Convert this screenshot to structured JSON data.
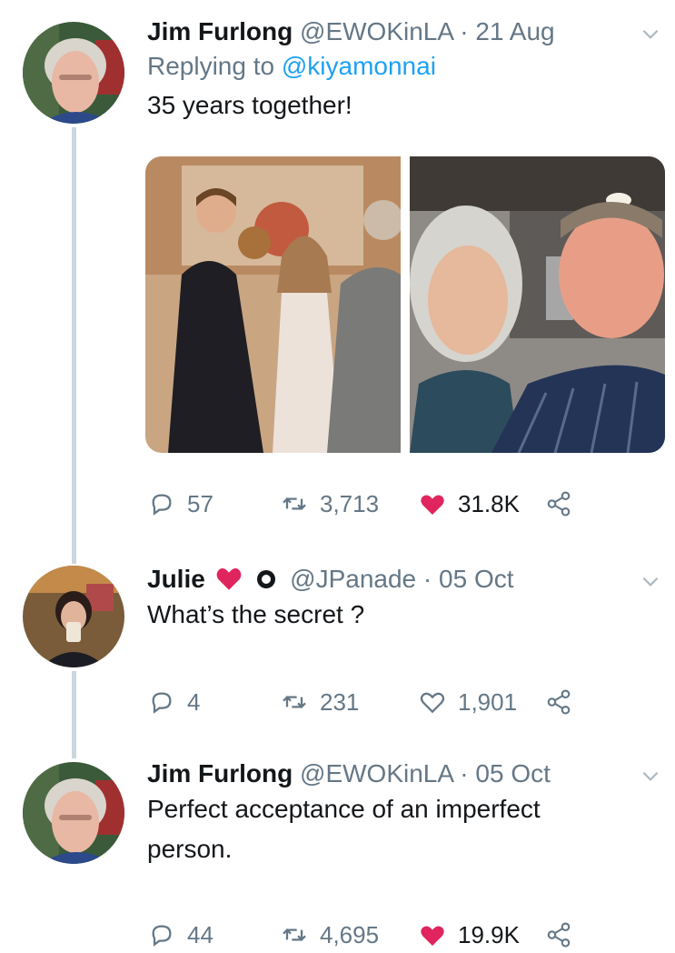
{
  "tweets": [
    {
      "name": "Jim Furlong",
      "handle": "@EWOKinLA",
      "dot": "·",
      "date": "21 Aug",
      "replying_prefix": "Replying to",
      "replying_to": "@kiyamonnai",
      "text": "35 years together!",
      "replies": "57",
      "retweets": "3,713",
      "likes": "31.8K",
      "liked": true
    },
    {
      "name": "Julie",
      "handle": "@JPanade",
      "dot": "·",
      "date": "05 Oct",
      "text": "What’s the secret ?",
      "replies": "4",
      "retweets": "231",
      "likes": "1,901",
      "liked": false
    },
    {
      "name": "Jim Furlong",
      "handle": "@EWOKinLA",
      "dot": "·",
      "date": "05 Oct",
      "text_line1": "Perfect acceptance of an imperfect",
      "text_line2": "person.",
      "replies": "44",
      "retweets": "4,695",
      "likes": "19.9K",
      "liked": true
    }
  ],
  "colors": {
    "text": "#14171a",
    "secondary": "#657786",
    "link": "#1da1f2",
    "like": "#e0245e",
    "thread_line": "#ccd6dd"
  },
  "icons": [
    "reply-icon",
    "retweet-icon",
    "heart-icon",
    "share-icon",
    "chevron-down-icon"
  ]
}
